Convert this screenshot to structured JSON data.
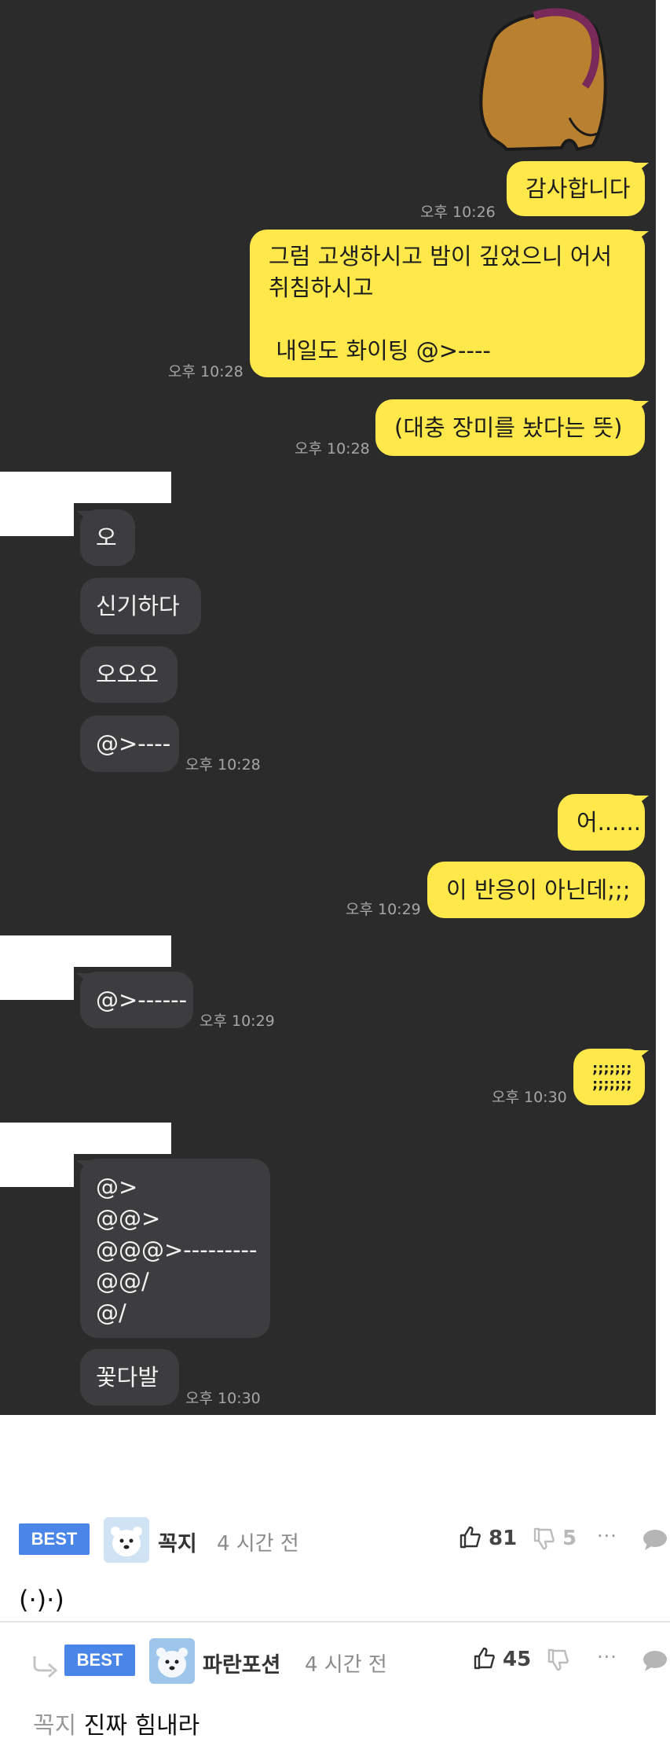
{
  "chat": {
    "messages": [
      {
        "side": "me",
        "text": "감사합니다",
        "time": "오후 10:26"
      },
      {
        "side": "me",
        "text": "그럼 고생하시고 밤이 깊었으니 어서\n취침하시고\n\n 내일도 화이팅 @>----",
        "time": "오후 10:28"
      },
      {
        "side": "me",
        "text": "(대충 장미를 놨다는 뜻)",
        "time": "오후 10:28"
      },
      {
        "side": "other",
        "text": "오"
      },
      {
        "side": "other",
        "text": "신기하다"
      },
      {
        "side": "other",
        "text": "오오오"
      },
      {
        "side": "other",
        "text": "@>----",
        "time": "오후 10:28"
      },
      {
        "side": "me",
        "text": "어......"
      },
      {
        "side": "me",
        "text": "이 반응이 아닌데;;;",
        "time": "오후 10:29"
      },
      {
        "side": "other",
        "text": "@>------",
        "time": "오후 10:29"
      },
      {
        "side": "me",
        "text": ";;;;;;;\n;;;;;;;",
        "time": "오후 10:30"
      },
      {
        "side": "other",
        "text": "@>\n@@>\n@@@>---------\n@@/\n@/"
      },
      {
        "side": "other",
        "text": "꽃다발",
        "time": "오후 10:30"
      }
    ]
  },
  "comments": [
    {
      "badge": "BEST",
      "author": "꼭지",
      "time": "4 시간 전",
      "upvotes": "81",
      "downvotes": "5",
      "more": "···",
      "text": "(·)·)",
      "avatar_icon": "polar-bear-avatar-icon"
    },
    {
      "badge": "BEST",
      "author": "파란포션",
      "time": "4 시간 전",
      "upvotes": "45",
      "downvotes": "",
      "more": "···",
      "reply_to": "꼭지",
      "text": "진짜 힘내라",
      "avatar_icon": "polar-bear-avatar-icon"
    }
  ],
  "colors": {
    "chat_bg": "#2b2b2c",
    "my_bubble": "#ffe84a",
    "their_bubble": "#3d3d3f",
    "best_badge": "#4a86e8"
  }
}
